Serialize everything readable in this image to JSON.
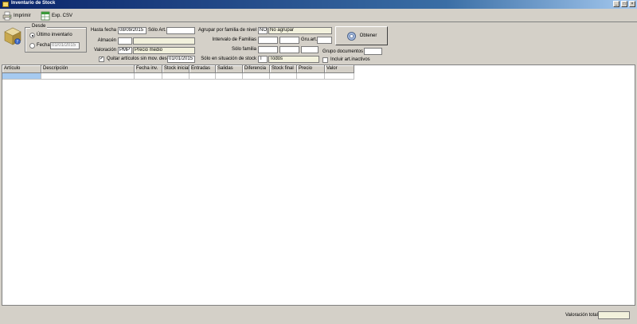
{
  "window": {
    "title": "Inventario de Stock",
    "controls": [
      "_",
      "□",
      "×"
    ]
  },
  "toolbar": {
    "print_label": "Imprimir",
    "export_label": "Exp. CSV"
  },
  "desde": {
    "group_title": "Desde",
    "ultimo_label": "Último inventario",
    "fecha_label": "Fecha",
    "fecha_value": "01/01/2015"
  },
  "filters": {
    "hasta_fecha_label": "Hasta fecha",
    "hasta_fecha_value": "08/09/2015",
    "solo_art_label": "Sólo Art.",
    "solo_art_value": "",
    "almacen_label": "Almacén",
    "almacen_code": "",
    "almacen_desc": "",
    "valoracion_label": "Valoración",
    "valoracion_code": "PMP",
    "valoracion_desc": "Precio medio",
    "quitar_label": "Quitar artículos sin mov. desde",
    "quitar_checked": true,
    "quitar_date": "01/01/2015"
  },
  "grouping": {
    "agrupar_label": "Agrupar por familia de nivel",
    "agrupar_code": "NO",
    "agrupar_desc": "No agrupar",
    "intervalo_label": "Intervalo de Familias",
    "intervalo_from": "",
    "intervalo_to": "",
    "gru_art_label": "Gru.art.",
    "gru_art_value": "",
    "solo_familia_label": "Sólo familia",
    "solo_familia_a": "",
    "solo_familia_b": "",
    "situacion_label": "Sólo en situación de stock",
    "situacion_code": "T",
    "situacion_desc": "Todos",
    "grupo_docs_label": "Grupo documentos",
    "grupo_docs_value": "",
    "incluir_inactivos_label": "Incluir art.inactivos",
    "incluir_inactivos_checked": false
  },
  "obtener_label": "Obtener",
  "grid": {
    "columns": [
      "Artículo",
      "Descripción",
      "Fecha inv.",
      "Stock inicial",
      "Entradas",
      "Salidas",
      "Diferencia",
      "Stock final",
      "Precio",
      "Valor"
    ],
    "rows": []
  },
  "status": {
    "valoracion_total_label": "Valoración total",
    "valoracion_total_value": ""
  }
}
